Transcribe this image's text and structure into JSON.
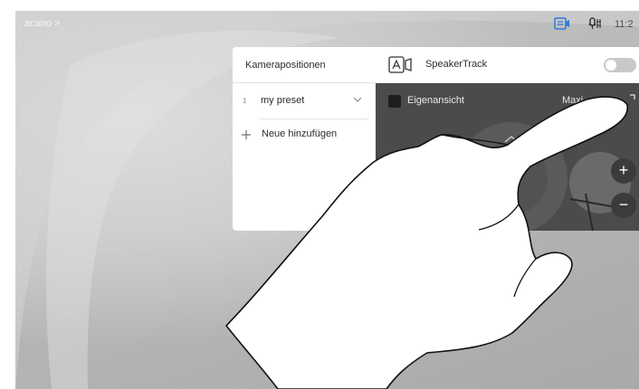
{
  "statusbar": {
    "breadcrumb": "acano",
    "breadcrumb_chevron": ">",
    "time": "11:2",
    "icons": [
      "camera-share-icon",
      "microphone-icon"
    ]
  },
  "camera_panel": {
    "title": "Kamerapositionen",
    "presets": [
      {
        "number": "1",
        "name": "my preset"
      }
    ],
    "add_label": "Neue hinzufügen"
  },
  "speakertrack": {
    "label": "SpeakerTrack",
    "enabled": false
  },
  "camera_view": {
    "self_view_label": "Eigenansicht",
    "maximize_label": "Maxi",
    "zoom_in": "+",
    "zoom_out": "−"
  },
  "colors": {
    "accent": "#2b7bd6",
    "panel_dark": "#4b4b4b",
    "panel_light": "#ffffff"
  }
}
